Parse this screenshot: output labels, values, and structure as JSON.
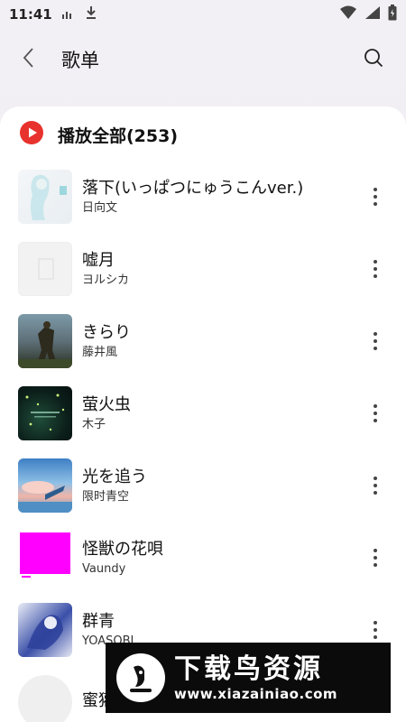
{
  "status": {
    "time": "11:41"
  },
  "header": {
    "title": "歌单"
  },
  "play_all": {
    "label": "播放全部(253)"
  },
  "songs": [
    {
      "title": "落下(いっぱつにゅうこんver.)",
      "artist": "日向文"
    },
    {
      "title": "嘘月",
      "artist": "ヨルシカ"
    },
    {
      "title": "きらり",
      "artist": "藤井風"
    },
    {
      "title": "萤火虫",
      "artist": "木子"
    },
    {
      "title": "光を追う",
      "artist": "限时青空"
    },
    {
      "title": "怪獣の花唄",
      "artist": "Vaundy"
    },
    {
      "title": "群青",
      "artist": "YOASOBI"
    },
    {
      "title": "蜜獾",
      "artist": ""
    }
  ],
  "watermark": {
    "title": "下载鸟资源",
    "url": "www.xiazainiao.com"
  },
  "colors": {
    "accent": "#e8322d",
    "magenta_cover": "#ff00ff"
  }
}
